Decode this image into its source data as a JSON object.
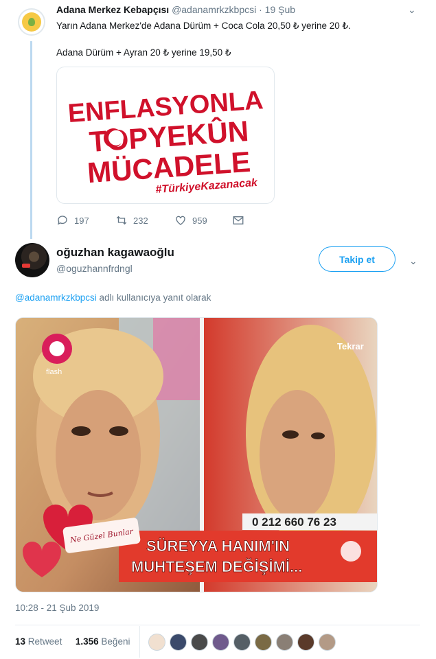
{
  "parent_tweet": {
    "name": "Adana Merkez Kebapçısı",
    "handle": "@adanamrkzkbpcsi",
    "separator": "·",
    "date": "19 Şub",
    "text_line1": "Yarın Adana Merkez'de Adana Dürüm + Coca Cola 20,50 ₺ yerine 20 ₺.",
    "text_line2": "Adana Dürüm + Ayran 20 ₺ yerine 19,50 ₺",
    "card": {
      "line1": "ENFLASYONLA",
      "line2": "TOPYEKÛN",
      "line3": "MÜCADELE",
      "hashtag": "#TürkiyeKazanacak",
      "color": "#d0112b"
    },
    "actions": {
      "replies": "197",
      "retweets": "232",
      "likes": "959"
    }
  },
  "reply_tweet": {
    "name": "oğuzhan kagawaoğlu",
    "handle": "@oguzhannfrdngl",
    "follow_label": "Takip et",
    "reply_mention": "@adanamrkzkbpcsi",
    "reply_suffix": " adlı kullanıcıya yanıt olarak",
    "media": {
      "logo_text": "flash",
      "tekrar_label": "Tekrar",
      "phone": "0 212 660 76 23",
      "banner_line1": "SÜREYYA HANIM'IN",
      "banner_line2": "MUHTEŞEM DEĞİŞİMİ...",
      "ribbon_text": "Ne Güzel Bunlar"
    },
    "timestamp": "10:28 - 21 Şub 2019",
    "retweet_count": "13",
    "retweet_label": "Retweet",
    "like_count": "1.356",
    "like_label": "Beğeni"
  },
  "colors": {
    "accent": "#1da1f2",
    "muted": "#657786",
    "brand_red": "#d0112b"
  }
}
